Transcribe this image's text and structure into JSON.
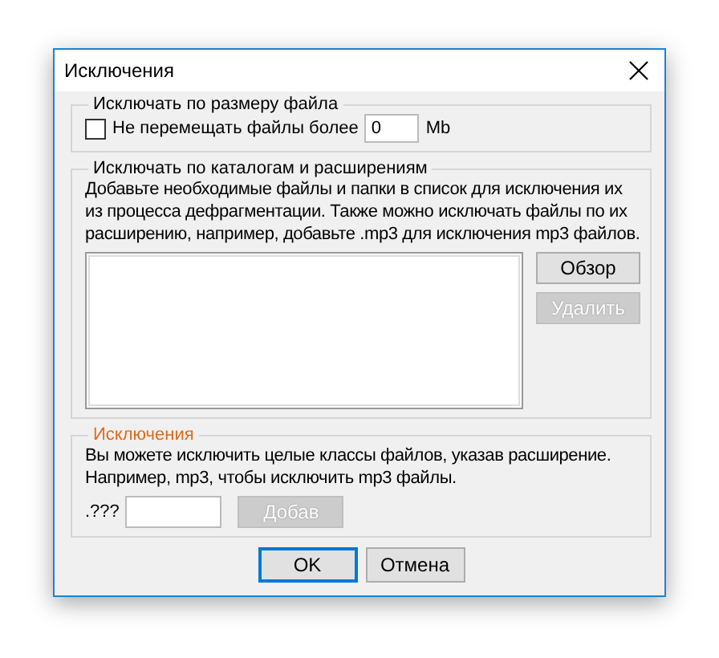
{
  "window": {
    "title": "Исключения"
  },
  "size_group": {
    "legend": "Исключать по размеру файла",
    "checkbox": {
      "label": "Не перемещать файлы более",
      "checked": false
    },
    "size_value": "0",
    "unit": "Mb"
  },
  "folder_group": {
    "legend": "Исключать по каталогам и расширениям",
    "description": "Добавьте необходимые файлы и папки в список для исключения их из процесса дефрагментации. Также можно исключать файлы по их расширению, например, добавьте .mp3 для исключения mp3 файлов.",
    "buttons": [
      {
        "label": "Обзор",
        "disabled": false
      },
      {
        "label": "Удалить",
        "disabled": true
      }
    ]
  },
  "extension_group": {
    "legend": "Исключения",
    "description": "Вы можете исключить целые классы файлов, указав расширение. Например, mp3, чтобы исключить mp3 файлы.",
    "prefix": ".???",
    "button": {
      "label": "Добав",
      "disabled": true
    }
  },
  "footer_buttons": [
    {
      "label": "OK",
      "default": true
    },
    {
      "label": "Отмена",
      "default": false
    }
  ]
}
